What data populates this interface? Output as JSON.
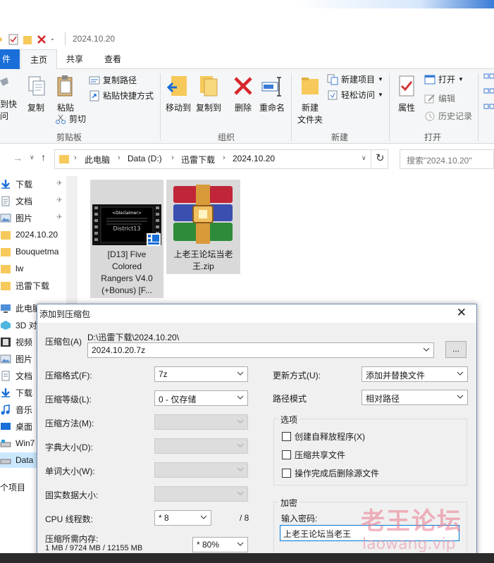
{
  "window": {
    "title": "2024.10.20"
  },
  "ribbon": {
    "tabs": [
      {
        "label": "件"
      },
      {
        "label": "主页"
      },
      {
        "label": "共享"
      },
      {
        "label": "查看"
      }
    ],
    "clipboard": {
      "pin_label_1": "定到快",
      "pin_label_2": "访问",
      "copy": "复制",
      "paste": "粘贴",
      "copy_path": "复制路径",
      "paste_shortcut": "粘贴快捷方式",
      "cut": "剪切",
      "group": "剪贴板"
    },
    "organize": {
      "move_to": "移动到",
      "copy_to": "复制到",
      "delete": "删除",
      "rename": "重命名",
      "group": "组织"
    },
    "new": {
      "new_folder_1": "新建",
      "new_folder_2": "文件夹",
      "new_item": "新建项目",
      "easy_access": "轻松访问",
      "group": "新建"
    },
    "open": {
      "properties": "属性",
      "open": "打开",
      "edit": "编辑",
      "history": "历史记录",
      "group": "打开"
    }
  },
  "address": {
    "crumbs": [
      "此电脑",
      "Data (D:)",
      "迅雷下载",
      "2024.10.20"
    ],
    "search_placeholder": "搜索\"2024.10.20\""
  },
  "nav": {
    "items": [
      "下载",
      "文档",
      "图片",
      "2024.10.20",
      "Bouquetma",
      "lw",
      "迅雷下载",
      "此电脑",
      "3D 对",
      "视频",
      "图片",
      "文档",
      "下载",
      "音乐",
      "桌面",
      "Win7",
      "Data"
    ]
  },
  "files": [
    {
      "name_lines": [
        "[D13] Five",
        "Colored",
        "Rangers V4.0",
        "(+Bonus) [F..."
      ],
      "thumb_title": "<Disclaimer>",
      "thumb_sub": "District13"
    },
    {
      "name_lines": [
        "上老王论坛当老",
        "王.zip"
      ]
    }
  ],
  "status": {
    "count": "个项目"
  },
  "dialog": {
    "title": "添加到压缩包",
    "archive_label": "压缩包(A)",
    "archive_path": "D:\\迅雷下载\\2024.10.20\\",
    "archive_name": "2024.10.20.7z",
    "browse": "...",
    "format_label": "压缩格式(F):",
    "format_value": "7z",
    "level_label": "压缩等级(L):",
    "level_value": "0 - 仅存储",
    "method_label": "压缩方法(M):",
    "dict_label": "字典大小(D):",
    "word_label": "单词大小(W):",
    "solid_label": "固实数据大小:",
    "cpu_label": "CPU 线程数:",
    "cpu_value": "* 8",
    "cpu_max": "/ 8",
    "mem_label": "压缩所需内存:",
    "mem_detail": "1 MB / 9724 MB / 12155 MB",
    "mem_value": "* 80%",
    "update_label": "更新方式(U):",
    "update_value": "添加并替换文件",
    "path_label": "路径模式",
    "path_value": "相对路径",
    "options_legend": "选项",
    "opt_sfx": "创建自释放程序(X)",
    "opt_shared": "压缩共享文件",
    "opt_delete": "操作完成后删除源文件",
    "encrypt_legend": "加密",
    "password_label": "输入密码:",
    "password_value": "上老王论坛当老王"
  },
  "watermark": {
    "line1": "老王论坛",
    "line2": "laowang.vip"
  },
  "colors": {
    "accent": "#1a6ed8",
    "selection": "#cce8ff",
    "dialog_bg": "#f0f0f0"
  }
}
